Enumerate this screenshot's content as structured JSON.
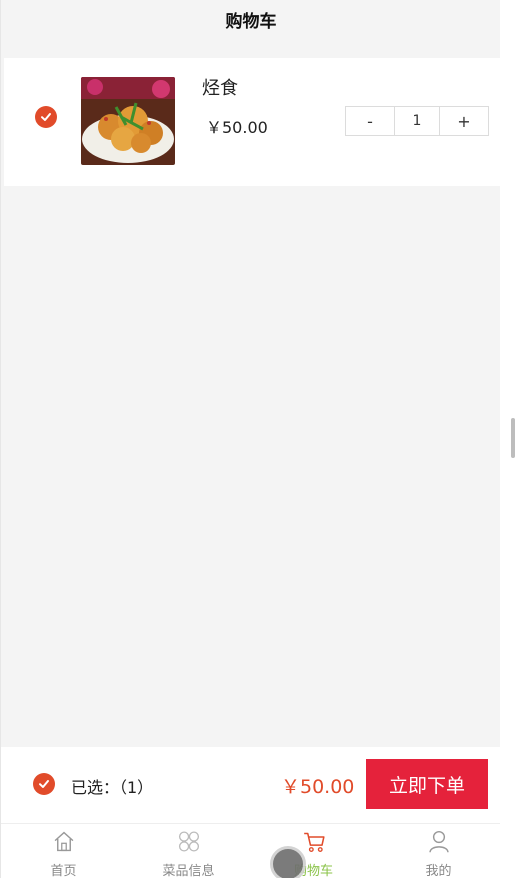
{
  "header": {
    "title": "购物车"
  },
  "cart": {
    "items": [
      {
        "name": "烃食",
        "price": "￥50.00",
        "quantity": "1",
        "checked": true,
        "image": "fried-food-photo"
      }
    ],
    "stepper": {
      "minus": "-",
      "plus": "+"
    }
  },
  "summary": {
    "selected_label": "已选：（1）",
    "total": "￥50.00",
    "order_button": "立即下单"
  },
  "tabbar": {
    "tabs": [
      {
        "label": "首页",
        "icon": "home-icon",
        "active": false
      },
      {
        "label": "菜品信息",
        "icon": "grid-icon",
        "active": false
      },
      {
        "label": "购物车",
        "icon": "cart-icon",
        "active": true
      },
      {
        "label": "我的",
        "icon": "user-icon",
        "active": false
      }
    ]
  },
  "colors": {
    "accent": "#e14b2a",
    "order_button": "#e5223b",
    "active_tab_label": "#8bc34a",
    "background": "#f4f4f4"
  }
}
